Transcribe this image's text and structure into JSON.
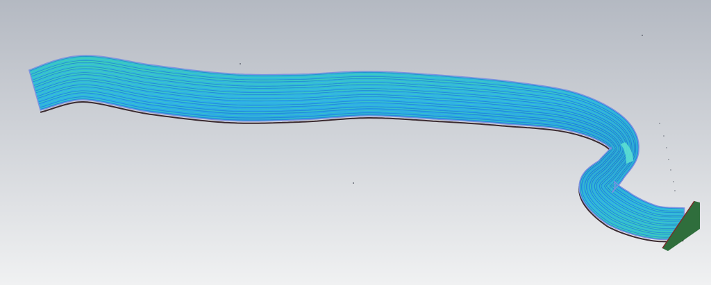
{
  "scene": {
    "background_top": "#b4b9c2",
    "background_bottom": "#f0f1f2",
    "toolpath_light": "#2fb0e8",
    "toolpath_dark": "#1d7fd4",
    "toolpath_teal": "#3fcfb8",
    "outline_color": "#7d92e0",
    "edge_dark": "#3b2a30",
    "end_face_color": "#2f6e3c",
    "side_face_color": "#5fe3d2"
  }
}
